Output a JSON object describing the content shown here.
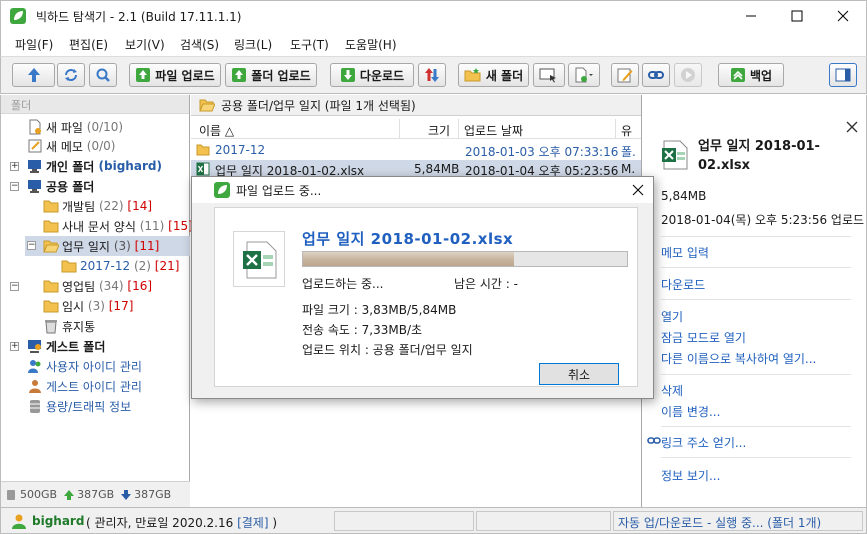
{
  "window": {
    "title": "빅하드 탐색기 - 2.1 (Build 17.11.1.1)",
    "controls": [
      "minimize",
      "maximize",
      "close"
    ]
  },
  "menu": [
    "파일(F)",
    "편집(E)",
    "보기(V)",
    "검색(S)",
    "링크(L)",
    "도구(T)",
    "도움말(H)"
  ],
  "toolbar": {
    "upload_file": "파일 업로드",
    "upload_folder": "폴더 업로드",
    "download": "다운로드",
    "new_folder": "새 폴더",
    "backup": "백업"
  },
  "left": {
    "header": "폴더",
    "tree": [
      {
        "label": "새 파일",
        "count": "(0/10)"
      },
      {
        "label": "새 메모",
        "count": "(0/0)"
      },
      {
        "label": "개인 폴더",
        "extra": "(bighard)"
      },
      {
        "label": "공용 폴더"
      },
      {
        "label": "개발팀",
        "count": "(22)",
        "red": "[14]"
      },
      {
        "label": "사내 문서 양식",
        "count": "(11)",
        "red": "[15]"
      },
      {
        "label": "업무 일지",
        "count": "(3)",
        "red": "[11]"
      },
      {
        "label": "2017-12",
        "count": "(2)",
        "red": "[21]"
      },
      {
        "label": "영업팀",
        "count": "(34)",
        "red": "[16]"
      },
      {
        "label": "임시",
        "count": "(3)",
        "red": "[17]"
      },
      {
        "label": "휴지통"
      },
      {
        "label": "게스트 폴더"
      },
      {
        "label": "사용자 아이디 관리"
      },
      {
        "label": "게스트 아이디 관리"
      },
      {
        "label": "용량/트래픽 정보"
      }
    ],
    "quota": {
      "total": "500GB",
      "up": "387GB",
      "down": "387GB"
    }
  },
  "center": {
    "path": "공용 폴더/업무 일지 (파일 1개 선택됨)",
    "columns": {
      "name": "이름 △",
      "size": "크기",
      "date": "업로드 날짜",
      "extra": "유"
    },
    "rows": [
      {
        "name": "2017-12",
        "size": "",
        "date": "2018-01-03 오후 07:33:16",
        "extra": "폴."
      },
      {
        "name": "업무 일지 2018-01-02.xlsx",
        "size": "5,84MB",
        "date": "2018-01-04 오후 05:23:56",
        "extra": "M."
      }
    ]
  },
  "right": {
    "filename": "업무 일지 2018-01-02.xlsx",
    "size": "5,84MB",
    "date": "2018-01-04(목) 오후 5:23:56 업로드",
    "actions": {
      "memo": "메모 입력",
      "download": "다운로드",
      "open": "열기",
      "open_locked": "잠금 모드로 열기",
      "open_as": "다른 이름으로 복사하여 열기...",
      "delete": "삭제",
      "rename": "이름 변경...",
      "link": "링크 주소 얻기...",
      "info": "정보 보기..."
    }
  },
  "dialog": {
    "title": "파일 업로드 중...",
    "filename": "업무 일지 2018-01-02.xlsx",
    "progress": 0.65,
    "status": "업로드하는 중...",
    "remaining": "남은 시간 : -",
    "file_size": "파일 크기 : 3,83MB/5,84MB",
    "speed": "전송 속도 : 7,33MB/초",
    "location": "업로드 위치 : 공용 폴더/업무 일지",
    "cancel": "취소"
  },
  "status": {
    "user": "bighard",
    "info": "( 관리자, 만료일 2020.2.16 ",
    "pay": "[결제]",
    "close_paren": " )",
    "transfer": "자동 업/다운로드 - 실행 중... (폴더 1개)"
  },
  "colors": {
    "accent": "#1f5fbf",
    "red": "#d00000",
    "selection": "#cfd8e6",
    "excel": "#1e7145",
    "leaf": "#3ea83e"
  }
}
